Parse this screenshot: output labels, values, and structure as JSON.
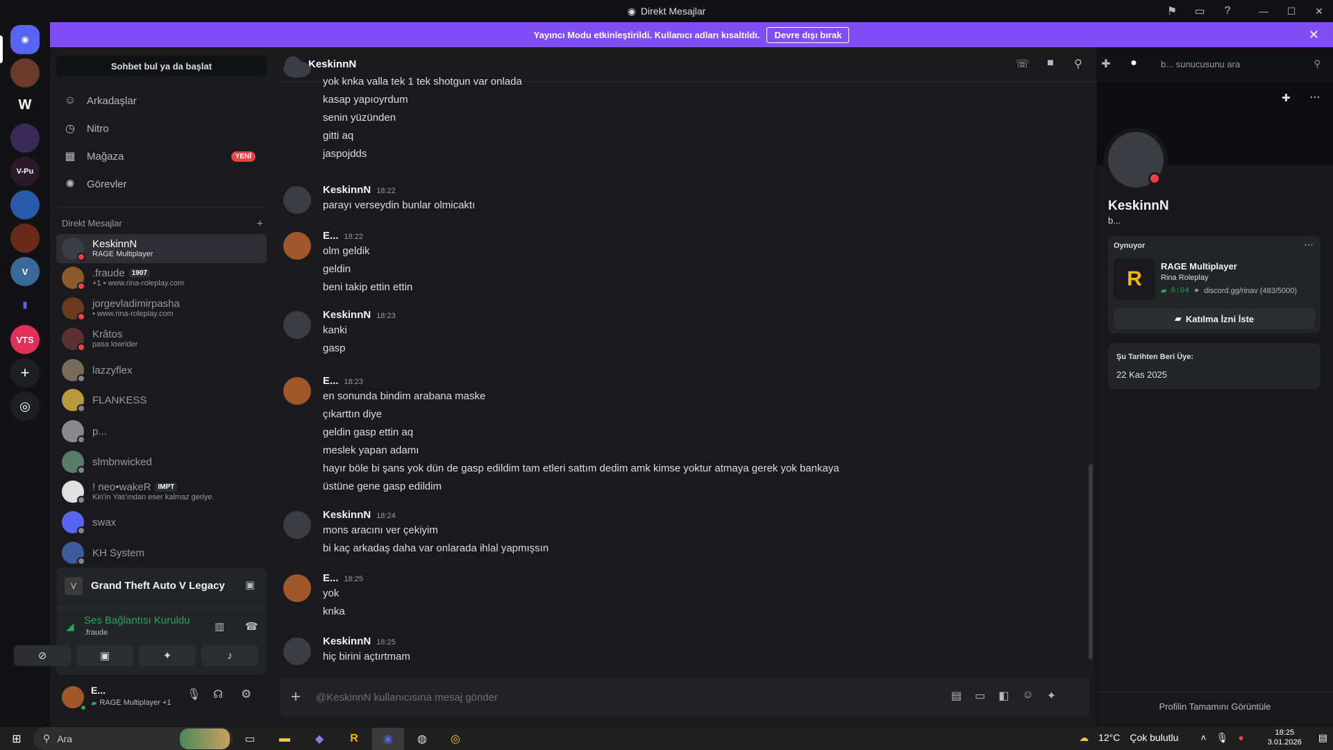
{
  "window": {
    "title": "Direkt Mesajlar"
  },
  "banner": {
    "text": "Yayıncı Modu etkinleştirildi. Kullanıcı adları kısaltıldı.",
    "button": "Devre dışı bırak"
  },
  "sidebar": {
    "find_placeholder": "Sohbet bul ya da başlat",
    "nav": [
      {
        "label": "Arkadaşlar",
        "icon": "friends-icon"
      },
      {
        "label": "Nitro",
        "icon": "nitro-icon"
      },
      {
        "label": "Mağaza",
        "icon": "shop-icon",
        "badge": "YENİ"
      },
      {
        "label": "Görevler",
        "icon": "quests-icon"
      }
    ],
    "dm_header": "Direkt Mesajlar",
    "dms": [
      {
        "name": "KeskinnN",
        "sub": "RAGE Multiplayer",
        "status": "dnd",
        "color": "#3a3d44",
        "active": true
      },
      {
        "name": ".fraude",
        "tag": "1907",
        "sub": "+1 • www.rina-roleplay.com",
        "status": "dnd",
        "color": "#8a5a2b"
      },
      {
        "name": "jorgevladimirpasha",
        "sub": "• www.rina-roleplay.com",
        "status": "dnd",
        "color": "#6b3a1e"
      },
      {
        "name": "Krâtos",
        "sub": "pasa lowrider",
        "status": "dnd",
        "color": "#5a3030"
      },
      {
        "name": "lazzyflex",
        "sub": "",
        "status": "offline",
        "color": "#7a6a5a"
      },
      {
        "name": "FLANKESS",
        "sub": "",
        "status": "offline",
        "color": "#b89a3a"
      },
      {
        "name": "p...",
        "sub": "",
        "status": "offline",
        "color": "#8a8a8a"
      },
      {
        "name": "slmbnwicked",
        "sub": "",
        "status": "offline",
        "color": "#5a7a6a"
      },
      {
        "name": "! neo•wakeR",
        "tag": "IMPT",
        "sub": "Kin'in Yas'ından eser kalmaz geriye.",
        "status": "offline",
        "color": "#e0e0e0"
      },
      {
        "name": "swax",
        "sub": "",
        "status": "offline",
        "color": "#5865f2"
      },
      {
        "name": "KH System",
        "sub": "",
        "status": "offline",
        "color": "#3a5a9a"
      }
    ]
  },
  "voice": {
    "game": "Grand Theft Auto V Legacy",
    "connection": "Ses Bağlantısı Kuruldu",
    "channel": ".fraude"
  },
  "user": {
    "name": "E...",
    "activity": "RAGE Multiplayer +1"
  },
  "chat": {
    "recipient": "KeskinnN",
    "search_placeholder": "b... sunucusunu ara",
    "composer_placeholder": "@KeskinnN kullanıcısına mesaj gönder",
    "messages": [
      {
        "author": "",
        "time": "",
        "av": "#3a3d44",
        "lines": [
          "yok knka valla tek 1 tek shotgun var onlada",
          "kasap yapıoyrdum",
          "senin yüzünden",
          "gitti aq",
          "jaspojdds"
        ]
      },
      {
        "author": "KeskinnN",
        "time": "18:22",
        "av": "#3a3d44",
        "lines": [
          "parayı verseydin bunlar olmicaktı"
        ]
      },
      {
        "author": "E...",
        "time": "18:22",
        "av": "#a0582b",
        "lines": [
          "olm geldik",
          "geldin",
          "beni takip ettin ettin"
        ]
      },
      {
        "author": "KeskinnN",
        "time": "18:23",
        "av": "#3a3d44",
        "lines": [
          "kanki",
          "gasp"
        ]
      },
      {
        "author": "E...",
        "time": "18:23",
        "av": "#a0582b",
        "lines": [
          "en sonunda bindim arabana maske",
          "çıkarttın diye",
          "geldin gasp ettin aq",
          "meslek yapan adamı",
          "hayır böle bi şans yok dün de gasp edildim tam etleri sattım dedim amk kimse yoktur atmaya gerek yok bankaya",
          "üstüne gene gasp edildim"
        ]
      },
      {
        "author": "KeskinnN",
        "time": "18:24",
        "av": "#3a3d44",
        "lines": [
          "mons aracını ver çekiyim",
          "bi kaç arkadaş daha var onlarada ihlal yapmışsın"
        ]
      },
      {
        "author": "E...",
        "time": "18:25",
        "av": "#a0582b",
        "lines": [
          "yok",
          "knka"
        ]
      },
      {
        "author": "KeskinnN",
        "time": "18:25",
        "av": "#3a3d44",
        "lines": [
          "hiç birini açtırtmam"
        ]
      }
    ]
  },
  "profile": {
    "name": "KeskinnN",
    "handle": "b...",
    "activity_header": "Oynuyor",
    "game": "RAGE Multiplayer",
    "server": "Rina Roleplay",
    "elapsed": "0:04",
    "invite": "discord.gg/rinav (483/5000)",
    "join_button": "Katılma İzni İste",
    "member_since_label": "Şu Tarihten Beri Üye:",
    "member_since": "22 Kas 2025",
    "view_full": "Profilin Tamamını Görüntüle"
  },
  "taskbar": {
    "search": "Ara",
    "weather": "12°C",
    "weather_desc": "Çok bulutlu",
    "time": "18:25",
    "date": "3.01.2026"
  },
  "colors": {
    "accent": "#5865f2",
    "banner": "#7f4ff5",
    "dnd": "#f23f43",
    "green": "#23a55a"
  }
}
